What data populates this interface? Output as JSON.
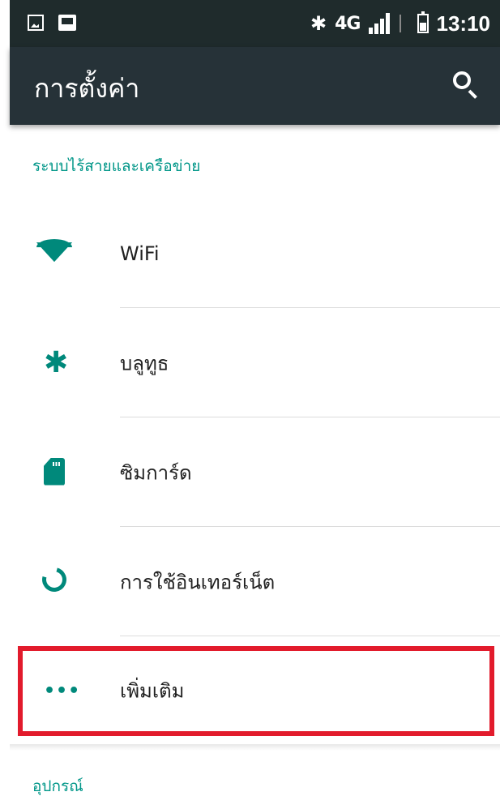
{
  "status_bar": {
    "network_type": "4G",
    "time": "13:10",
    "icons": [
      "image-notification-icon",
      "message-notification-icon",
      "bluetooth-icon",
      "signal-icon",
      "data-arrows-icon",
      "battery-icon"
    ]
  },
  "app_bar": {
    "title": "การตั้งค่า",
    "search_icon": "search-icon"
  },
  "sections": {
    "wireless_header": "ระบบไร้สายและเครือข่าย",
    "device_header": "อุปกรณ์"
  },
  "items": [
    {
      "label": "WiFi",
      "icon": "wifi-icon"
    },
    {
      "label": "บลูทูธ",
      "icon": "bluetooth-icon"
    },
    {
      "label": "ซิมการ์ด",
      "icon": "sim-card-icon"
    },
    {
      "label": "การใช้อินเทอร์เน็ต",
      "icon": "data-usage-icon"
    },
    {
      "label": "เพิ่มเติม",
      "icon": "more-icon"
    }
  ],
  "more_dots": "•••",
  "colors": {
    "accent": "#009688",
    "icon": "#00897b",
    "app_bar": "#263238",
    "status_bar": "#1f2b2c",
    "highlight": "#e21b2c"
  }
}
